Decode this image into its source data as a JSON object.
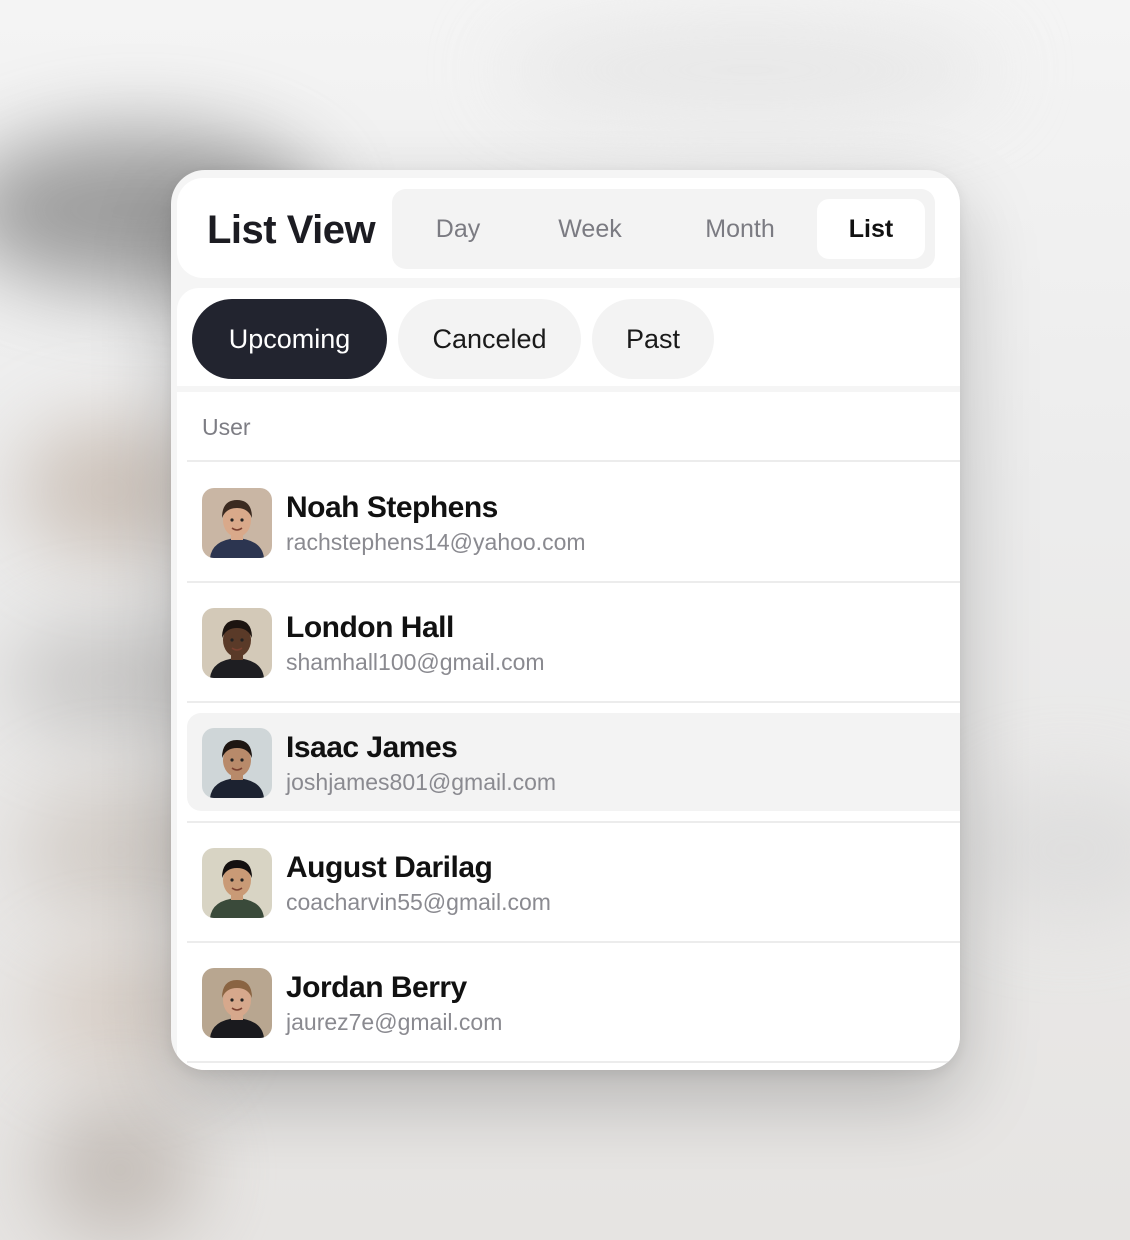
{
  "header": {
    "title": "List View",
    "view_tabs": [
      {
        "label": "Day",
        "active": false
      },
      {
        "label": "Week",
        "active": false
      },
      {
        "label": "Month",
        "active": false
      },
      {
        "label": "List",
        "active": true
      }
    ]
  },
  "filters": [
    {
      "label": "Upcoming",
      "active": true
    },
    {
      "label": "Canceled",
      "active": false
    },
    {
      "label": "Past",
      "active": false
    }
  ],
  "table": {
    "column_header": "User",
    "rows": [
      {
        "name": "Noah Stephens",
        "email": "rachstephens14@yahoo.com",
        "avatar": "user-photo-icon",
        "skin": "#d9a98a",
        "hair": "#3b2a20",
        "bg": "#c9b6a4",
        "shirt": "#2c3550",
        "highlighted": false
      },
      {
        "name": "London Hall",
        "email": "shamhall100@gmail.com",
        "avatar": "user-photo-icon",
        "skin": "#5a3a28",
        "hair": "#1c1410",
        "bg": "#d3c9b8",
        "shirt": "#1e1e22",
        "highlighted": false
      },
      {
        "name": "Isaac James",
        "email": "joshjames801@gmail.com",
        "avatar": "user-photo-icon",
        "skin": "#b88a6a",
        "hair": "#1e1612",
        "bg": "#cfd6d8",
        "shirt": "#1c2230",
        "highlighted": true
      },
      {
        "name": "August Darilag",
        "email": "coacharvin55@gmail.com",
        "avatar": "user-photo-icon",
        "skin": "#c99a76",
        "hair": "#141010",
        "bg": "#d8d4c4",
        "shirt": "#3a4a3a",
        "highlighted": false
      },
      {
        "name": "Jordan Berry",
        "email": "jaurez7e@gmail.com",
        "avatar": "user-photo-icon",
        "skin": "#d6a88c",
        "hair": "#8a6442",
        "bg": "#b8a690",
        "shirt": "#1a1a1e",
        "highlighted": false
      }
    ]
  },
  "colors": {
    "accent_dark": "#22242f",
    "muted_text": "#8a8a90"
  }
}
